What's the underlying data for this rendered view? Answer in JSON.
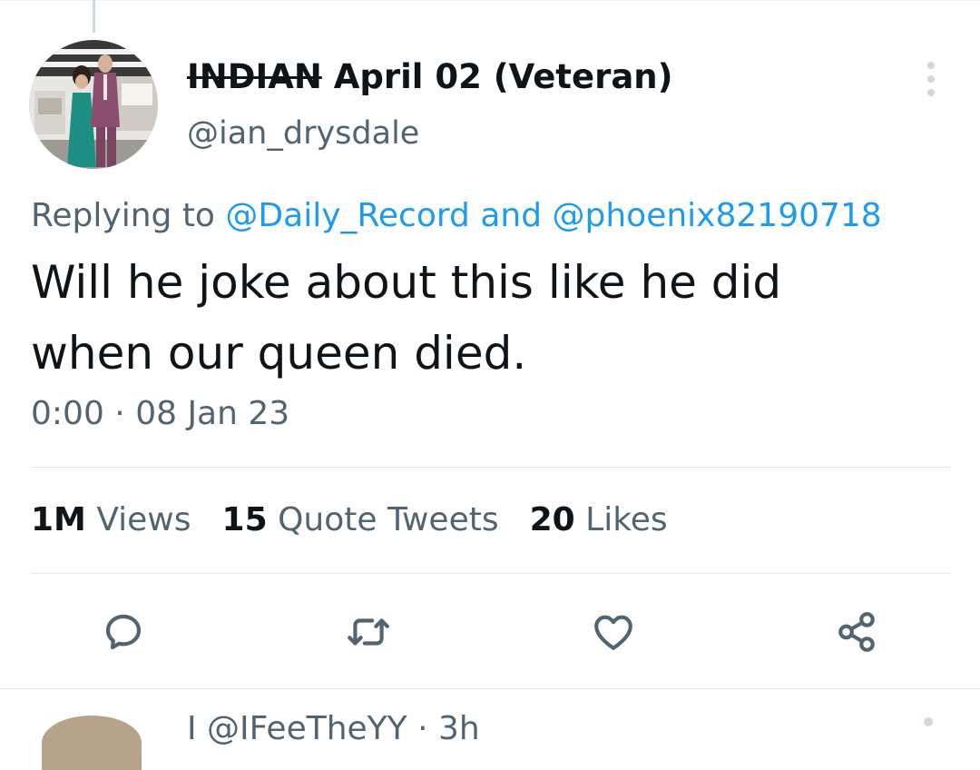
{
  "tweet": {
    "author": {
      "name_struck": "INDIAN",
      "name_rest": " April 02 (Veteran)",
      "handle": "@ian_drysdale"
    },
    "replying": {
      "prefix": "Replying to ",
      "target1": "@Daily_Record",
      "joiner": " and ",
      "target2": "@phoenix82190718"
    },
    "text_line1": "Will he joke about this like he did",
    "text_line2": "when our queen died.",
    "time": "0:00",
    "separator": " · ",
    "date": "08 Jan 23",
    "stats": {
      "views_count": "1M",
      "views_label": " Views",
      "quotes_count": "15",
      "quotes_label": " Quote Tweets",
      "likes_count": "20",
      "likes_label": " Likes"
    }
  },
  "next_tweet": {
    "partial_text": "I @IFeeTheYY · 3h"
  },
  "icons": {
    "reply": "reply-icon",
    "retweet": "retweet-icon",
    "like": "heart-icon",
    "share": "share-icon",
    "more": "more-icon"
  },
  "colors": {
    "link": "#1d9bf0",
    "secondary_text": "#536471",
    "primary_text": "#0f1419"
  }
}
